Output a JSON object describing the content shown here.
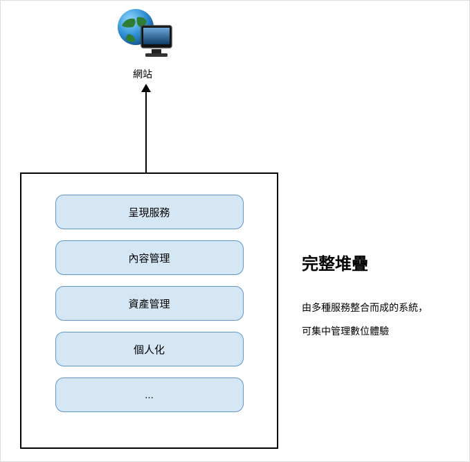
{
  "top": {
    "label": "網站",
    "icon_name": "globe-monitor-icon"
  },
  "stack": {
    "services": [
      {
        "label": "呈現服務"
      },
      {
        "label": "內容管理"
      },
      {
        "label": "資產管理"
      },
      {
        "label": "個人化"
      },
      {
        "label": "..."
      }
    ]
  },
  "side": {
    "title": "完整堆疊",
    "desc_line1": "由多種服務整合而成的系統，",
    "desc_line2": "可集中管理數位體驗"
  },
  "colors": {
    "service_box_fill": "#d5e6f4",
    "service_box_border": "#5b95c9",
    "stack_border": "#000000",
    "arrow": "#000000"
  }
}
